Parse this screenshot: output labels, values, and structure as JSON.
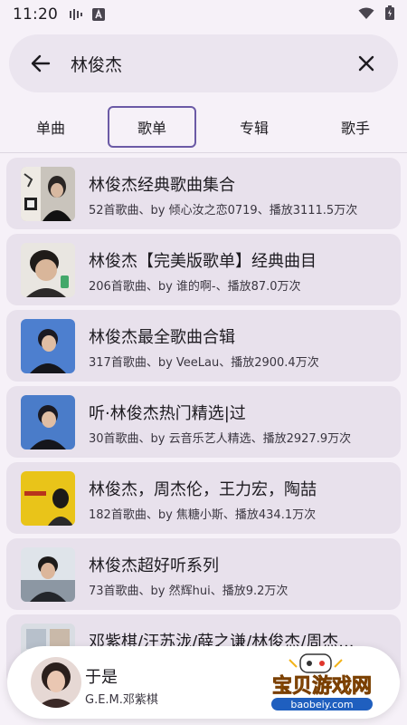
{
  "status": {
    "time": "11:20"
  },
  "search": {
    "query": "林俊杰"
  },
  "tabs": [
    "单曲",
    "歌单",
    "专辑",
    "歌手"
  ],
  "active_tab": 1,
  "playlists": [
    {
      "title": "林俊杰经典歌曲集合",
      "meta": "52首歌曲、by 倾心汝之恋0719、播放3111.5万次"
    },
    {
      "title": "林俊杰【完美版歌单】经典曲目",
      "meta": "206首歌曲、by 谁的啊-、播放87.0万次"
    },
    {
      "title": "林俊杰最全歌曲合辑",
      "meta": "317首歌曲、by VeeLau、播放2900.4万次"
    },
    {
      "title": "听·林俊杰热门精选|过",
      "meta": "30首歌曲、by 云音乐艺人精选、播放2927.9万次"
    },
    {
      "title": "林俊杰，周杰伦，王力宏，陶喆",
      "meta": "182首歌曲、by 焦糖小斯、播放434.1万次"
    },
    {
      "title": "林俊杰超好听系列",
      "meta": "73首歌曲、by 然辉hui、播放9.2万次"
    },
    {
      "title": "邓紫棋/汪苏泷/薛之谦/林俊杰/周杰...",
      "meta": ""
    }
  ],
  "player": {
    "title": "于是",
    "artist": "G.E.M.邓紫棋"
  },
  "watermark": {
    "text": "宝贝游戏网",
    "url": "baobeiy.com"
  },
  "colors": {
    "accent": "#6b5aa6",
    "card": "#e8e1ec",
    "background": "#f6f1f8"
  }
}
